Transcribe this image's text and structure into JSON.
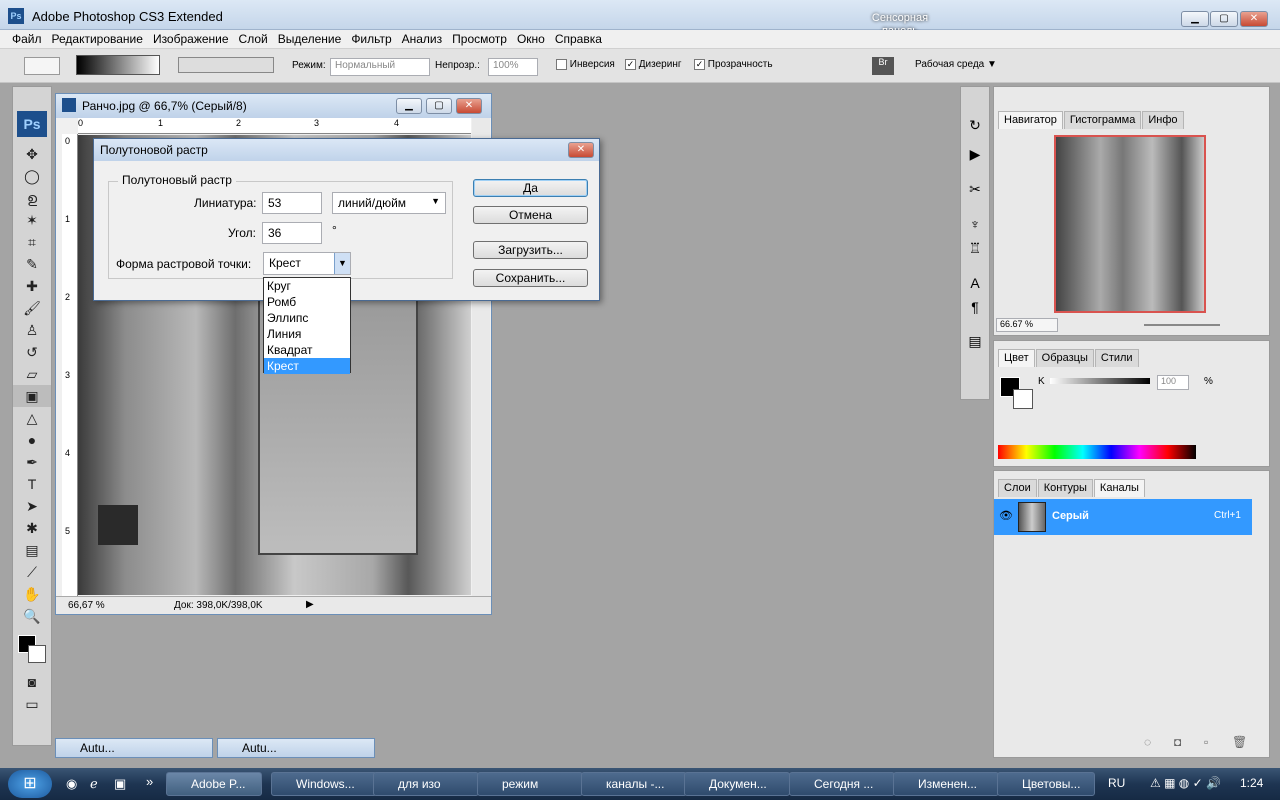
{
  "window": {
    "title": "Adobe Photoshop CS3 Extended",
    "touch_panel": "Сенсорная панель",
    "ps_logo": "Ps"
  },
  "menu": [
    "Файл",
    "Редактирование",
    "Изображение",
    "Слой",
    "Выделение",
    "Фильтр",
    "Анализ",
    "Просмотр",
    "Окно",
    "Справка"
  ],
  "options": {
    "mode_label": "Режим:",
    "mode_value": "Нормальный",
    "opacity_label": "Непрозр.:",
    "opacity_value": "100%",
    "invert": "Инверсия",
    "dither": "Дизеринг",
    "transparency": "Прозрачность",
    "workspace": "Рабочая среда"
  },
  "document": {
    "title": "Ранчо.jpg @ 66,7% (Серый/8)",
    "zoom": "66,67 %",
    "doc_info": "Док: 398,0K/398,0K",
    "ruler_top": [
      "0",
      "1",
      "2",
      "3",
      "4"
    ],
    "ruler_left": [
      "0",
      "1",
      "2",
      "3",
      "4",
      "5"
    ]
  },
  "dialog": {
    "title": "Полутоновой растр",
    "group": "Полутоновый растр",
    "frequency_label": "Линиатура:",
    "frequency_value": "53",
    "frequency_unit": "линий/дюйм",
    "angle_label": "Угол:",
    "angle_value": "36",
    "angle_unit": "°",
    "shape_label": "Форма растровой точки:",
    "shape_value": "Крест",
    "shape_options": [
      "Круг",
      "Ромб",
      "Эллипс",
      "Линия",
      "Квадрат",
      "Крест"
    ],
    "shape_selected_index": 5,
    "ok": "Да",
    "cancel": "Отмена",
    "load": "Загрузить...",
    "save": "Сохранить..."
  },
  "navigator": {
    "tabs": [
      "Навигатор",
      "Гистограмма",
      "Инфо"
    ],
    "zoom": "66.67 %"
  },
  "color": {
    "tabs": [
      "Цвет",
      "Образцы",
      "Стили"
    ],
    "channel": "K",
    "value": "100",
    "unit": "%"
  },
  "channels": {
    "tabs": [
      "Слои",
      "Контуры",
      "Каналы"
    ],
    "row_name": "Серый",
    "row_shortcut": "Ctrl+1"
  },
  "minimized": [
    {
      "label": "Autu..."
    },
    {
      "label": "Autu..."
    }
  ],
  "taskbar": {
    "items": [
      "Adobe P...",
      "Windows...",
      "для изо",
      "режим",
      "каналы -...",
      "Докумен...",
      "Сегодня ...",
      "Изменен...",
      "Цветовы..."
    ],
    "lang": "RU",
    "time": "1:24"
  }
}
